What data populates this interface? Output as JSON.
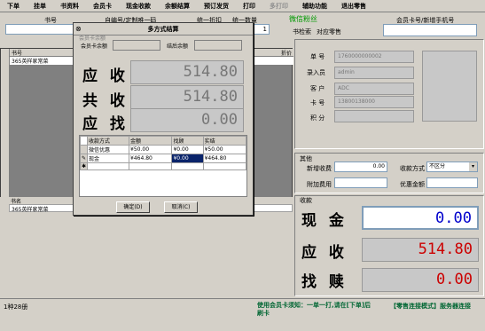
{
  "toolbar": {
    "items": [
      "下单",
      "挂单",
      "书资料",
      "会员卡",
      "现金收款",
      "余额结算",
      "预订发货",
      "打印",
      "多打印",
      "辅助功能",
      "退出零售"
    ],
    "disabled_index": 8
  },
  "top": {
    "book_no_label": "书号",
    "author_label": "自编号/定制唯一码",
    "discount_label": "统一折扣",
    "qty_label": "统一数量",
    "qty_value": "1",
    "wechat_link": "微信粉丝",
    "book_search_btn": "书检索",
    "counter_label": "对应零售",
    "member_label": "会员卡号/新增手机号"
  },
  "list": {
    "header_no": "书号",
    "header_price": "折价",
    "row1_name": "365英样家常菜",
    "footer_header": "书名",
    "footer_row": "365英样家常菜",
    "status_count": "1种28册"
  },
  "dialog": {
    "title": "多方式结算",
    "member_balance_group": "会员卡余额",
    "member_balance_label": "会员卡余额",
    "after_balance_label": "结后余额",
    "receivable_label": "应 收",
    "receivable": "514.80",
    "paid_label": "共 收",
    "paid": "514.80",
    "change_label": "应 找",
    "change": "0.00",
    "table_headers": [
      "收款方式",
      "金额",
      "找顾",
      "实结"
    ],
    "rows": [
      [
        "微信优惠",
        "¥50.00",
        "¥0.00",
        "¥50.00"
      ],
      [
        "现金",
        "¥464.80",
        "¥0.00",
        "¥464.80"
      ]
    ],
    "ok": "确定(D)",
    "cancel": "取消(C)"
  },
  "right": {
    "order_no_label": "单 号",
    "order_no": "1760000000002",
    "operator_label": "录入员",
    "operator": "admin",
    "customer_label": "客 户",
    "customer": "ADC",
    "card_label": "卡 号",
    "card": "13800138000",
    "points_label": "积 分",
    "other_label": "其他",
    "extra_fee_label": "新增收费",
    "extra_fee": "0.00",
    "pay_method_label": "收款方式",
    "pay_method": "不区分",
    "add_fee_label": "附加费用",
    "discount_amt_label": "优惠金额",
    "collect_label": "收款",
    "cash_label": "现 金",
    "cash": "0.00",
    "receive_label": "应 收",
    "receive": "514.80",
    "change_label": "找 赎",
    "change": "0.00"
  },
  "footer": {
    "notice": "使用会员卡须知：一单一打,请在[下单]后刷卡",
    "mode": "【零售连接模式】服务器连接"
  },
  "colors": {
    "cash": "#0000cc",
    "receive": "#cc0000",
    "change": "#cc0000",
    "link": "#009900",
    "footer": "#006633"
  }
}
